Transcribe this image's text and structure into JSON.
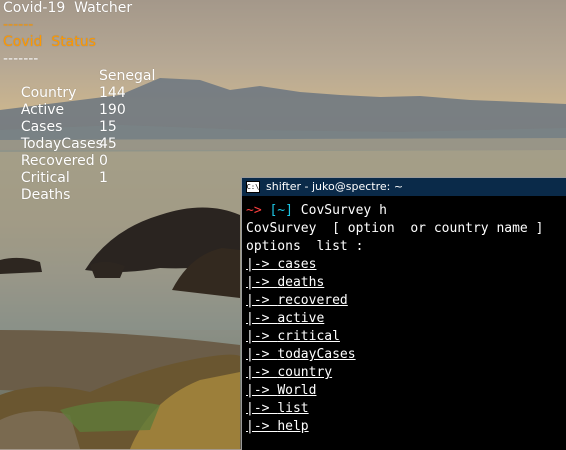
{
  "widget": {
    "title": "Covid-19  Watcher",
    "sep1": "------",
    "status_label": "Covid  Status",
    "sep2": "-------",
    "rows": [
      {
        "label": "Country",
        "value": "Senegal"
      },
      {
        "label": "Active",
        "value": "144"
      },
      {
        "label": "Cases",
        "value": "190"
      },
      {
        "label": "TodayCases",
        "value": "15"
      },
      {
        "label": "Recovered",
        "value": "45"
      },
      {
        "label": "Critical",
        "value": "0"
      },
      {
        "label": "Deaths",
        "value": "1"
      }
    ]
  },
  "terminal": {
    "title": "shifter - juko@spectre: ~",
    "icon_text": "C:\\",
    "prompt_tilde": "~",
    "prompt_arrow": ">",
    "prompt_path": "[~]",
    "command": "CovSurvey h",
    "usage": "CovSurvey  [ option  or country name ]",
    "options_header": "options  list :",
    "option_prefix": "|->",
    "options": [
      "cases",
      "deaths",
      "recovered",
      "active",
      "critical",
      "todayCases",
      "country",
      "World",
      "list",
      "help"
    ]
  },
  "colors": {
    "accent": "#ff9900",
    "terminal_bg": "#000000",
    "titlebar_bg": "#0a2a49",
    "prompt_red": "#ff4040",
    "prompt_cyan": "#1ec8e6"
  }
}
